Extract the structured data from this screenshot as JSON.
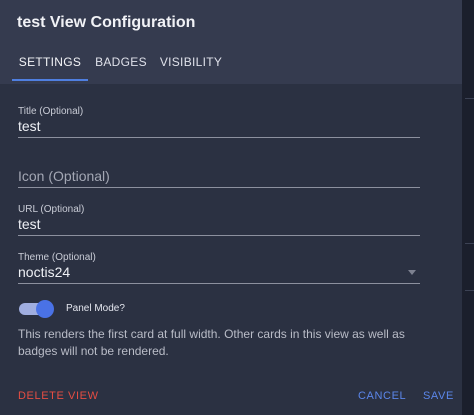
{
  "dialog": {
    "title": "test View Configuration",
    "tabs": [
      {
        "label": "SETTINGS",
        "active": true
      },
      {
        "label": "BADGES",
        "active": false
      },
      {
        "label": "VISIBILITY",
        "active": false
      }
    ]
  },
  "form": {
    "title_field": {
      "label": "Title (Optional)",
      "value": "test"
    },
    "icon_field": {
      "placeholder": "Icon (Optional)"
    },
    "url_field": {
      "label": "URL (Optional)",
      "value": "test"
    },
    "theme_field": {
      "label": "Theme (Optional)",
      "value": "noctis24"
    },
    "panel_mode": {
      "label": "Panel Mode?",
      "checked": true
    },
    "helper_text": "This renders the first card at full width. Other cards in this view as well as badges will not be rendered."
  },
  "actions": {
    "delete_label": "DELETE VIEW",
    "cancel_label": "CANCEL",
    "save_label": "SAVE"
  },
  "colors": {
    "accent": "#4f7fe0",
    "danger": "#e54d43",
    "surface": "#2b3142",
    "header": "#353b4f"
  }
}
